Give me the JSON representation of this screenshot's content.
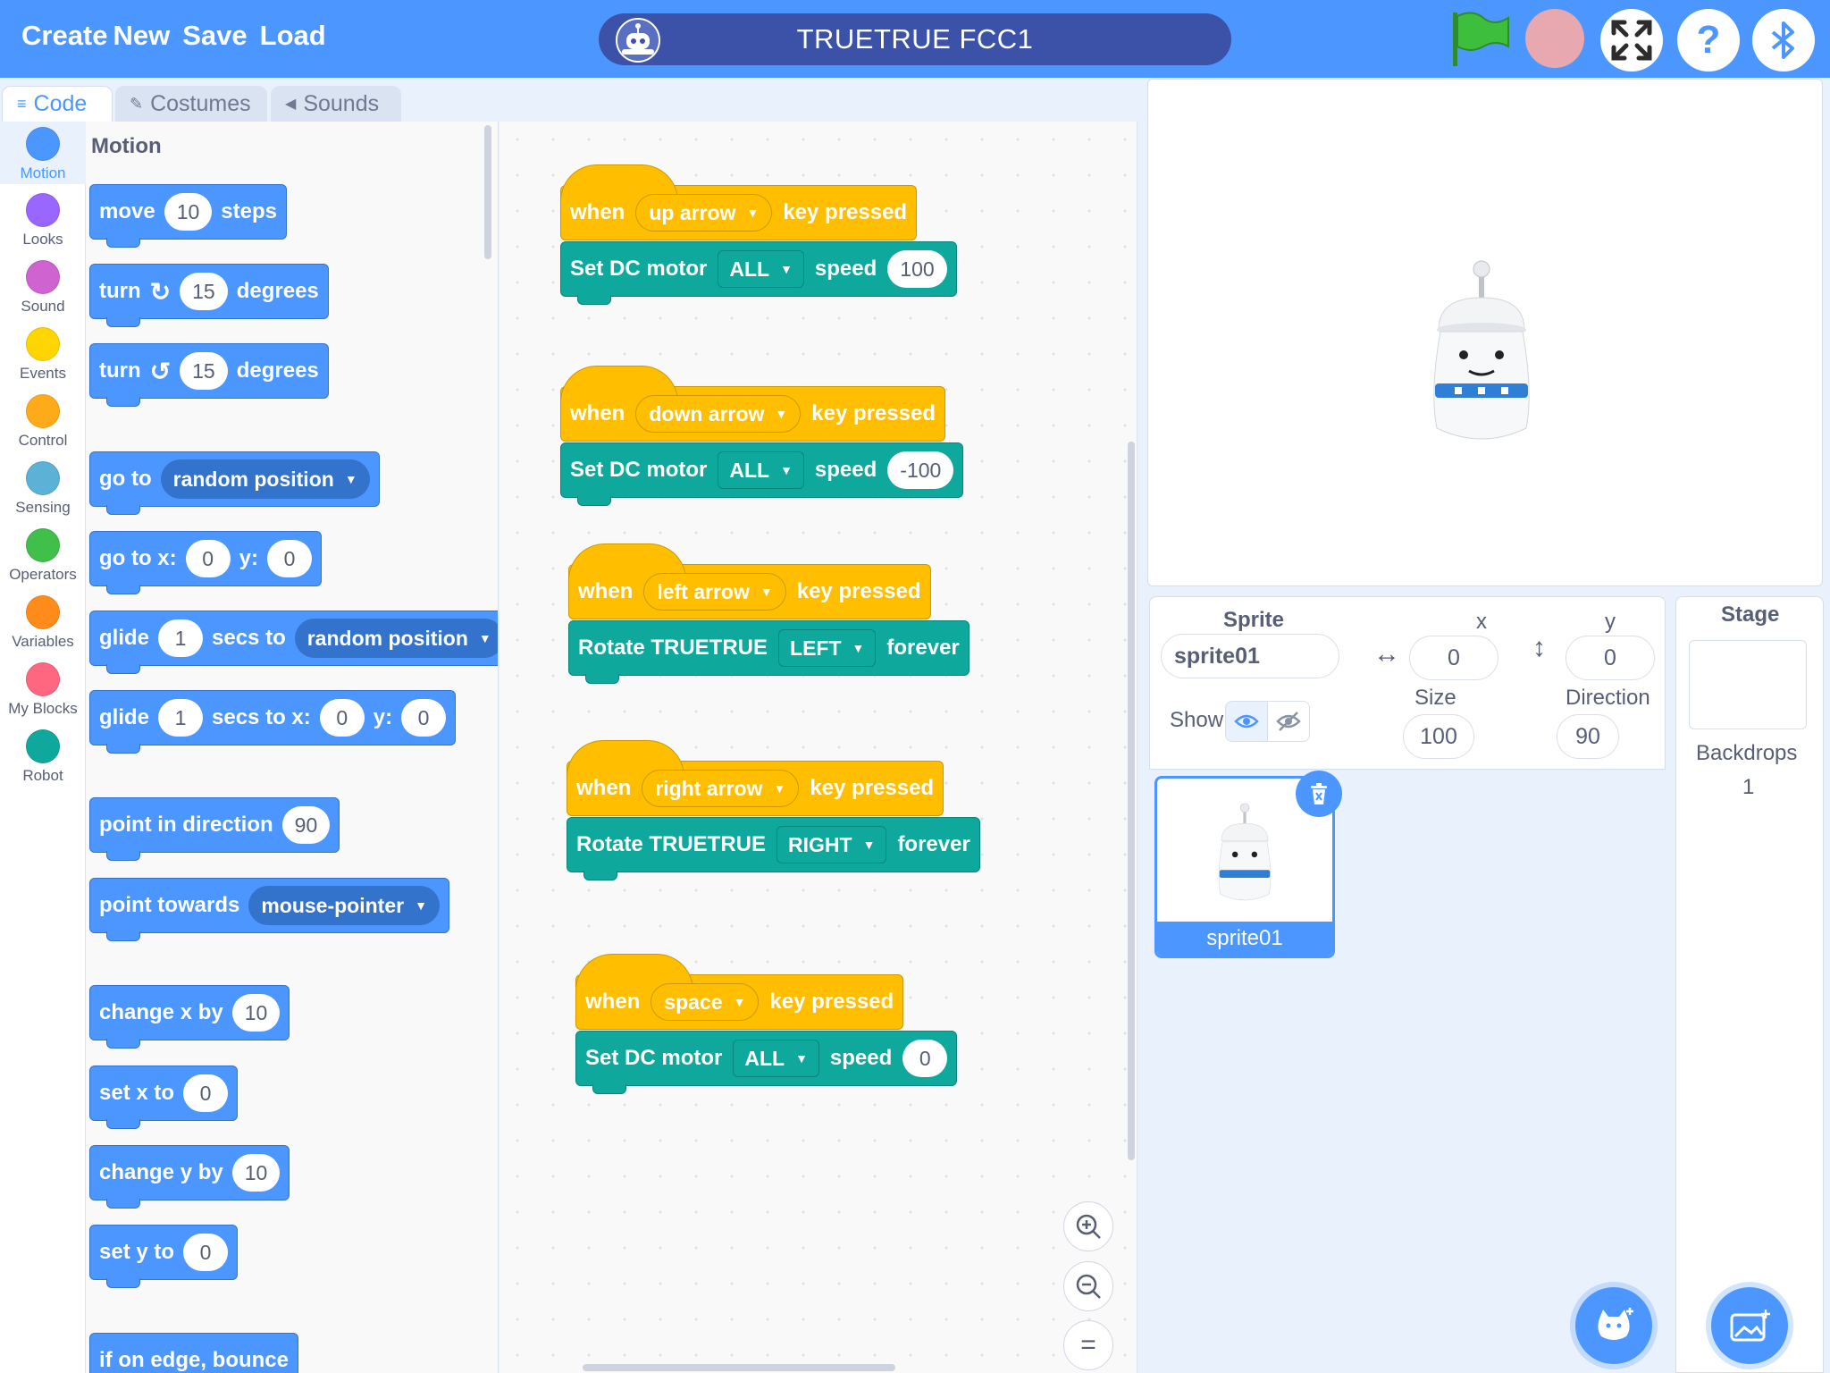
{
  "menu": {
    "create": "Create",
    "new": "New",
    "save": "Save",
    "load": "Load"
  },
  "project": {
    "title": "TRUETRUE FCC1"
  },
  "tabs": [
    {
      "label": "Code",
      "icon": "code-icon"
    },
    {
      "label": "Costumes",
      "icon": "brush-icon"
    },
    {
      "label": "Sounds",
      "icon": "speaker-icon"
    }
  ],
  "categories": [
    {
      "label": "Motion",
      "color": "#4c97ff"
    },
    {
      "label": "Looks",
      "color": "#9966ff"
    },
    {
      "label": "Sound",
      "color": "#cf63cf"
    },
    {
      "label": "Events",
      "color": "#ffd500"
    },
    {
      "label": "Control",
      "color": "#ffab19"
    },
    {
      "label": "Sensing",
      "color": "#5cb1d6"
    },
    {
      "label": "Operators",
      "color": "#40bf4a"
    },
    {
      "label": "Variables",
      "color": "#ff8c1a"
    },
    {
      "label": "My Blocks",
      "color": "#ff6680"
    },
    {
      "label": "Robot",
      "color": "#0fa89d"
    }
  ],
  "palette": {
    "title": "Motion",
    "move": {
      "a": "move",
      "v": "10",
      "b": "steps"
    },
    "turn_right": {
      "a": "turn",
      "v": "15",
      "b": "degrees"
    },
    "turn_left": {
      "a": "turn",
      "v": "15",
      "b": "degrees"
    },
    "goto": {
      "a": "go to",
      "d": "random position"
    },
    "goto_xy": {
      "a": "go to x:",
      "x": "0",
      "b": "y:",
      "y": "0"
    },
    "glide": {
      "a": "glide",
      "v": "1",
      "b": "secs to",
      "d": "random position"
    },
    "glide_xy": {
      "a": "glide",
      "v": "1",
      "b": "secs to x:",
      "x": "0",
      "c": "y:",
      "y": "0"
    },
    "point_dir": {
      "a": "point in direction",
      "v": "90"
    },
    "point_towards": {
      "a": "point towards",
      "d": "mouse-pointer"
    },
    "change_x": {
      "a": "change x by",
      "v": "10"
    },
    "set_x": {
      "a": "set x to",
      "v": "0"
    },
    "change_y": {
      "a": "change y by",
      "v": "10"
    },
    "set_y": {
      "a": "set y to",
      "v": "0"
    },
    "bounce": {
      "a": "if on edge, bounce"
    }
  },
  "scripts": [
    {
      "when": "when",
      "key": "up arrow",
      "pressed": "key pressed",
      "cmd": "Set DC motor",
      "opt": "ALL",
      "label": "speed",
      "val": "100"
    },
    {
      "when": "when",
      "key": "down arrow",
      "pressed": "key pressed",
      "cmd": "Set DC motor",
      "opt": "ALL",
      "label": "speed",
      "val": "-100"
    },
    {
      "when": "when",
      "key": "left arrow",
      "pressed": "key pressed",
      "cmd": "Rotate TRUETRUE",
      "opt": "LEFT",
      "label": "forever"
    },
    {
      "when": "when",
      "key": "right arrow",
      "pressed": "key pressed",
      "cmd": "Rotate TRUETRUE",
      "opt": "RIGHT",
      "label": "forever"
    },
    {
      "when": "when",
      "key": "space",
      "pressed": "key pressed",
      "cmd": "Set DC motor",
      "opt": "ALL",
      "label": "speed",
      "val": "0"
    }
  ],
  "sprite_info": {
    "sprite_label": "Sprite",
    "sprite_name": "sprite01",
    "x_label": "x",
    "x": "0",
    "y_label": "y",
    "y": "0",
    "show_label": "Show",
    "size_label": "Size",
    "size": "100",
    "direction_label": "Direction",
    "direction": "90"
  },
  "sprite_list": [
    {
      "name": "sprite01"
    }
  ],
  "stage_panel": {
    "title": "Stage",
    "backdrops_label": "Backdrops",
    "backdrops_count": "1"
  },
  "colors": {
    "motion": "#4c97ff",
    "events": "#ffbf00",
    "robot": "#0fa89d",
    "topbar": "#4c97ff"
  }
}
